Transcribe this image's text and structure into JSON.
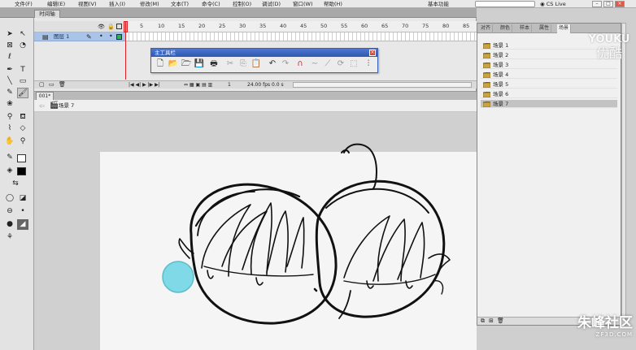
{
  "menu": {
    "items": [
      "文件(F)",
      "编辑(E)",
      "视图(V)",
      "插入(I)",
      "修改(M)",
      "文本(T)",
      "命令(C)",
      "控制(O)",
      "调试(D)",
      "窗口(W)",
      "帮助(H)"
    ],
    "workspace": "基本功能",
    "cslive": "CS Live"
  },
  "timeline": {
    "tab_label": "时间轴",
    "layer_name": "图层 1",
    "ruler_ticks": [
      "5",
      "10",
      "15",
      "20",
      "25",
      "30",
      "35",
      "40",
      "45",
      "50",
      "55",
      "60",
      "65",
      "70",
      "75",
      "80",
      "85"
    ],
    "status_frame": "1",
    "status_fps": "24.00 fps",
    "status_time": "0.0 s"
  },
  "main_toolbar": {
    "title": "主工具栏",
    "icons": [
      "new-icon",
      "open-icon",
      "open-folder-icon",
      "save-icon",
      "print-icon",
      "cut-icon",
      "copy-icon",
      "paste-icon",
      "undo-icon",
      "redo-icon",
      "snap-magnet-icon",
      "smooth-icon",
      "straighten-icon",
      "rotate-icon",
      "scale-icon",
      "align-icon"
    ]
  },
  "document": {
    "tab_label": "001*",
    "scene_crumb": "场景 7"
  },
  "scene_panel": {
    "tabs": [
      "对齐",
      "颜色",
      "样本",
      "属性",
      "场景"
    ],
    "active_tab": "场景",
    "scenes": [
      "场景 1",
      "场景 2",
      "场景 3",
      "场景 4",
      "场景 5",
      "场景 6",
      "场景 7"
    ],
    "selected_scene": "场景 7"
  },
  "watermarks": {
    "youku_en": "YOUKU",
    "youku_cn": "优酷",
    "zf_cn": "朱峰社区",
    "zf_en": "ZF3D.COM"
  },
  "colors": {
    "accent": "#3a63b8",
    "layer_selected": "#a9c4e8",
    "playhead": "#e02020",
    "brush_cursor": "#7fd9e6"
  }
}
